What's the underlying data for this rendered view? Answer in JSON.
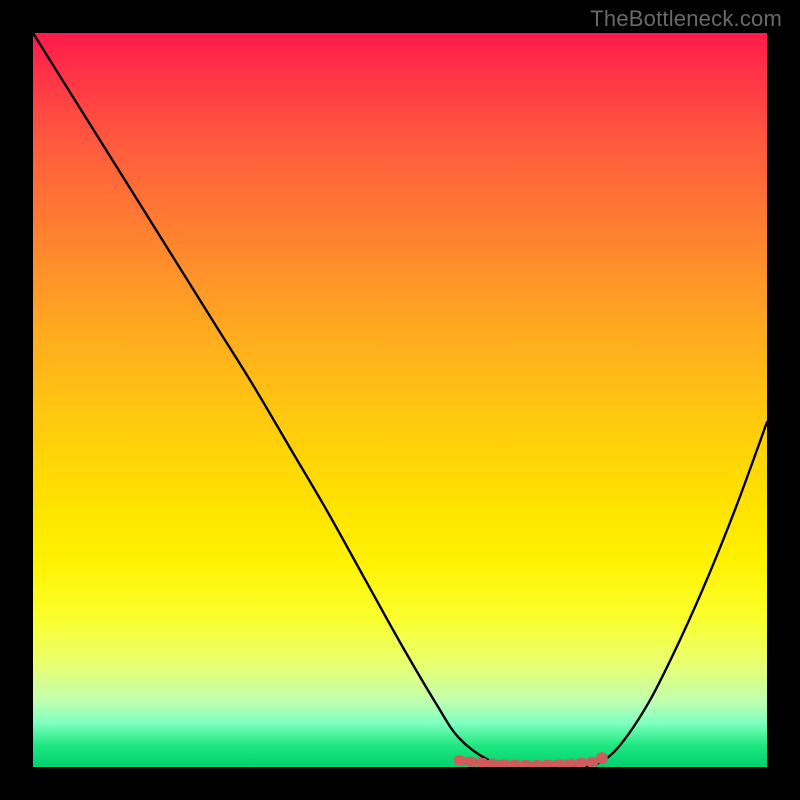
{
  "watermark": "TheBottleneck.com",
  "chart_data": {
    "type": "line",
    "title": "",
    "xlabel": "",
    "ylabel": "",
    "xlim": [
      0,
      100
    ],
    "ylim": [
      0,
      100
    ],
    "grid": false,
    "series": [
      {
        "name": "curve",
        "x": [
          0,
          5,
          10,
          15,
          20,
          25,
          30,
          35,
          40,
          45,
          50,
          55,
          58,
          62,
          66,
          70,
          74,
          77,
          80,
          84,
          88,
          92,
          96,
          100
        ],
        "y": [
          100,
          92,
          84,
          76,
          68,
          60,
          52,
          43.5,
          35,
          26,
          17,
          8.5,
          4,
          1,
          0,
          0,
          0,
          0.5,
          3,
          9,
          17,
          26,
          36,
          47
        ],
        "color": "#000000"
      }
    ],
    "markers": [
      {
        "x_start": 58,
        "x_end": 77,
        "y": 0.5,
        "color": "#cf5b5b",
        "style": "dashed-thick"
      },
      {
        "x": 77.5,
        "y": 1.2,
        "color": "#cf5b5b",
        "style": "dot"
      }
    ],
    "background": {
      "type": "vertical-gradient",
      "stops": [
        {
          "pos": 0,
          "color": "#ff1a4a"
        },
        {
          "pos": 50,
          "color": "#ffc810"
        },
        {
          "pos": 72,
          "color": "#fff200"
        },
        {
          "pos": 91,
          "color": "#c0ffb0"
        },
        {
          "pos": 100,
          "color": "#00d070"
        }
      ]
    }
  }
}
